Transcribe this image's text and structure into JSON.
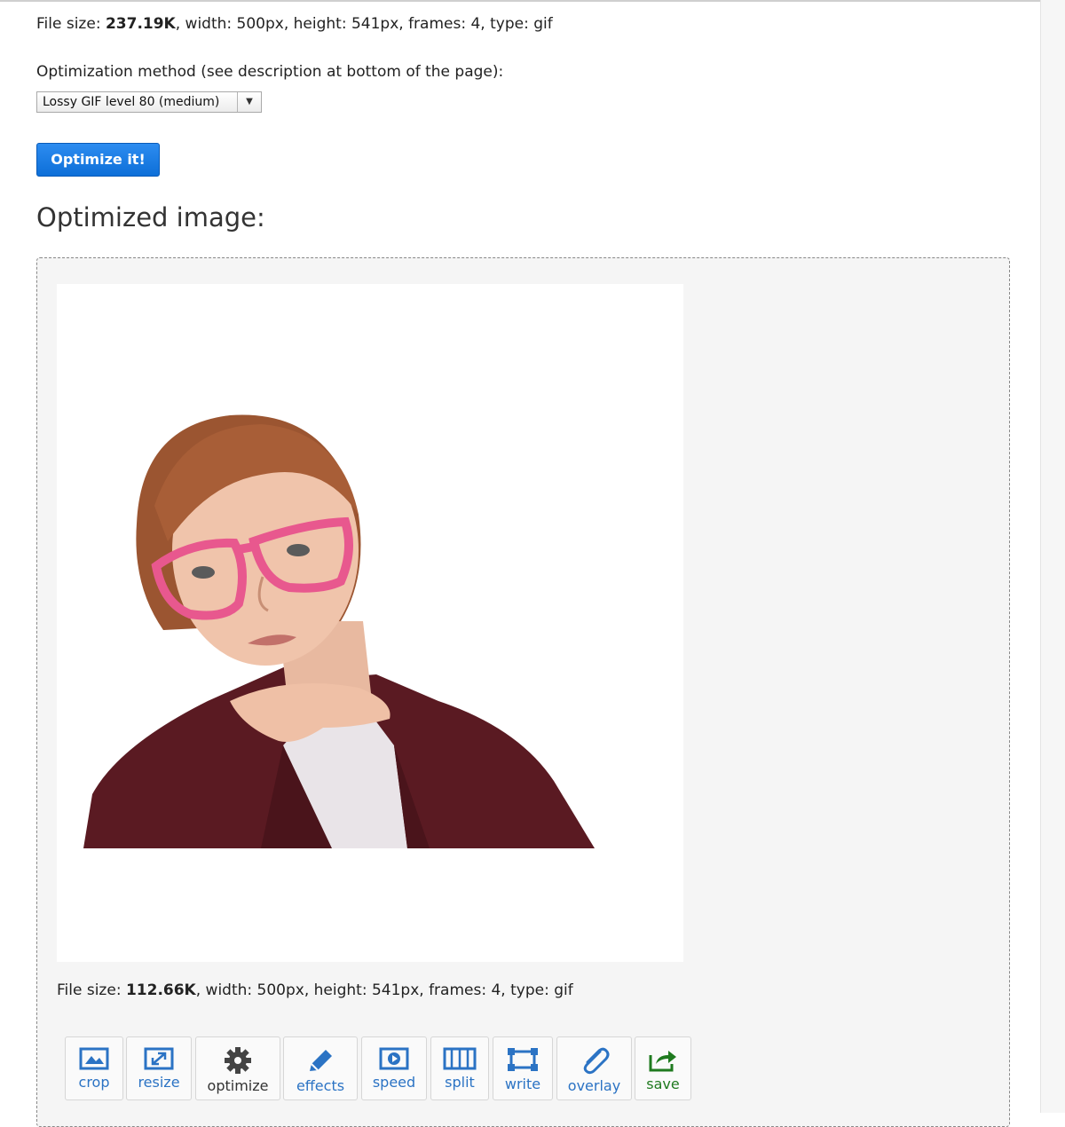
{
  "original": {
    "file_size_label": "File size: ",
    "file_size": "237.19K",
    "details": ", width: 500px, height: 541px, frames: 4, type: gif"
  },
  "method": {
    "label": "Optimization method (see description at bottom of the page):",
    "selected": "Lossy GIF level 80 (medium)"
  },
  "optimize_button": "Optimize it!",
  "result": {
    "title": "Optimized image:",
    "file_size_label": "File size: ",
    "file_size": "112.66K",
    "details": ", width: 500px, height: 541px, frames: 4, type: gif"
  },
  "tools": [
    {
      "label": "crop",
      "icon": "crop-icon"
    },
    {
      "label": "resize",
      "icon": "resize-icon"
    },
    {
      "label": "optimize",
      "icon": "gear-icon"
    },
    {
      "label": "effects",
      "icon": "pencil-icon"
    },
    {
      "label": "speed",
      "icon": "play-icon"
    },
    {
      "label": "split",
      "icon": "film-icon"
    },
    {
      "label": "write",
      "icon": "frame-icon"
    },
    {
      "label": "overlay",
      "icon": "paperclip-icon"
    },
    {
      "label": "save",
      "icon": "share-icon"
    }
  ],
  "colors": {
    "accent": "#2b73c4",
    "button": "#0d6fd8",
    "save": "#1f7a1f",
    "jacket": "#5a1a22",
    "glasses": "#e8588e"
  }
}
